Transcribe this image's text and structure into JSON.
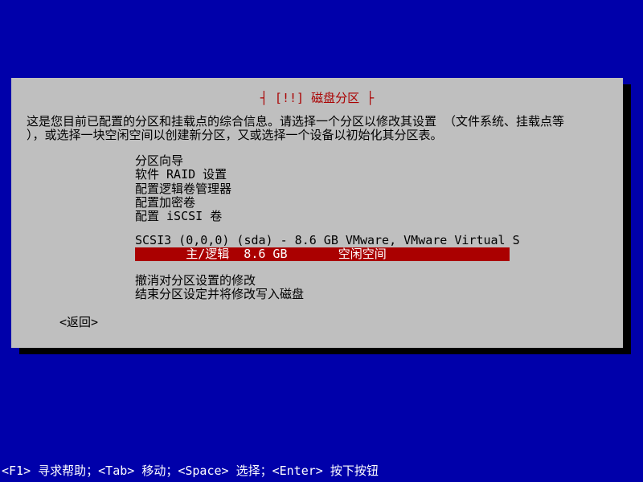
{
  "dialog": {
    "title": "┤ [!!] 磁盘分区 ├",
    "instruction_line1": "这是您目前已配置的分区和挂载点的综合信息。请选择一个分区以修改其设置 （文件系统、挂载点等",
    "instruction_line2": "），或选择一块空闲空间以创建新分区，又或选择一个设备以初始化其分区表。",
    "menu": {
      "guided": "分区向导",
      "raid": "软件 RAID 设置",
      "lvm": "配置逻辑卷管理器",
      "encrypted": "配置加密卷",
      "iscsi": "配置 iSCSI 卷"
    },
    "disk_header": "SCSI3 (0,0,0) (sda) - 8.6 GB VMware, VMware Virtual S",
    "selected_partition": "       主/逻辑  8.6 GB       空闲空间",
    "undo": "撤消对分区设置的修改",
    "finish": "结束分区设定并将修改写入磁盘",
    "back": "<返回>"
  },
  "help_bar": "<F1> 寻求帮助；<Tab> 移动；<Space> 选择；<Enter> 按下按钮"
}
